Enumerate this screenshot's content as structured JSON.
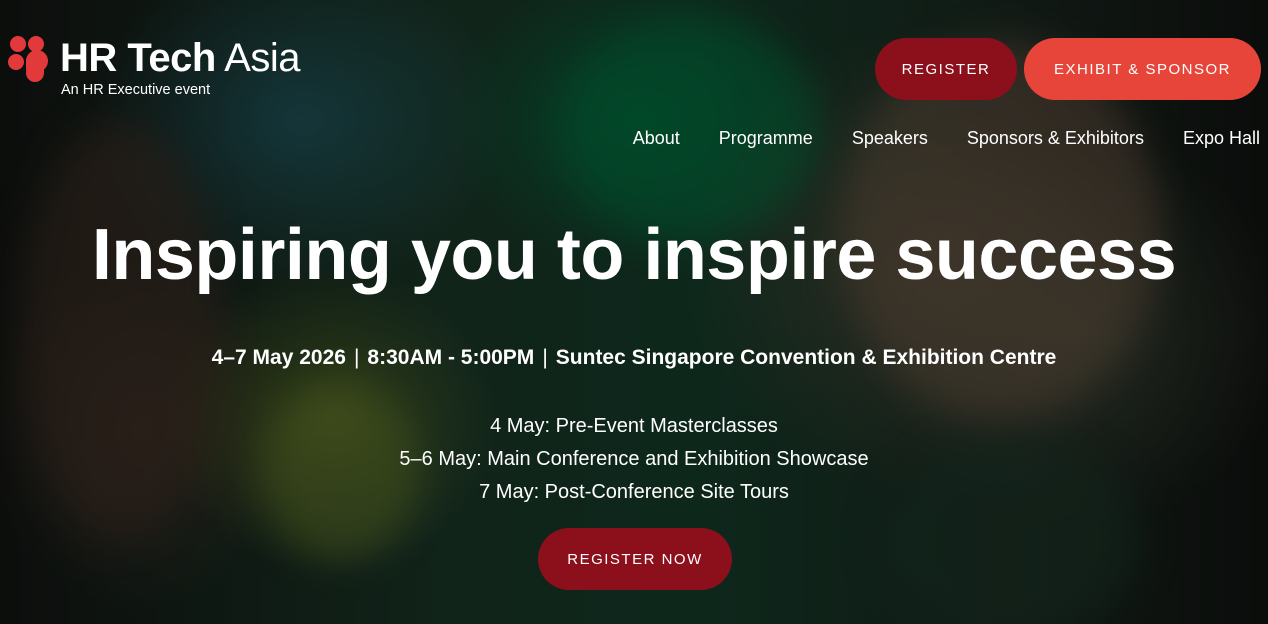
{
  "brand": {
    "name_bold": "HR Tech",
    "name_light": "Asia",
    "tagline": "An HR Executive event",
    "logo_color": "#e23a3a"
  },
  "header_buttons": {
    "register": "REGISTER",
    "exhibit": "EXHIBIT & SPONSOR"
  },
  "nav": {
    "items": [
      {
        "label": "About"
      },
      {
        "label": "Programme"
      },
      {
        "label": "Speakers"
      },
      {
        "label": "Sponsors & Exhibitors"
      },
      {
        "label": "Expo Hall"
      }
    ]
  },
  "hero": {
    "headline": "Inspiring you to inspire success",
    "dates": "4–7 May 2026",
    "separator": "|",
    "time": "8:30AM - 5:00PM",
    "venue": "Suntec Singapore Convention & Exhibition Centre",
    "schedule": [
      "4 May: Pre-Event Masterclasses",
      "5–6 May: Main Conference and Exhibition Showcase",
      "7 May: Post-Conference Site Tours"
    ],
    "cta": "REGISTER NOW"
  },
  "colors": {
    "register": "#8c0f1c",
    "exhibit": "#e8453a",
    "accent_red": "#e23a3a"
  }
}
